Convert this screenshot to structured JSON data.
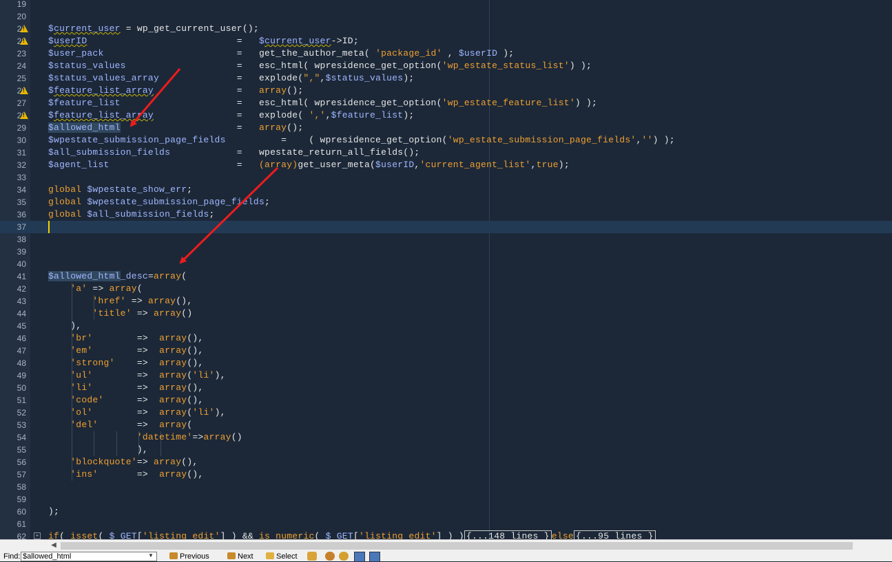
{
  "editor": {
    "lines": [
      {
        "n": "19",
        "warn": false,
        "parts": []
      },
      {
        "n": "20",
        "warn": false,
        "parts": []
      },
      {
        "n": "21",
        "warn": true,
        "parts": [
          [
            "v",
            "$"
          ],
          [
            "v squig",
            "current_user"
          ],
          [
            "o",
            " = "
          ],
          [
            "f",
            "wp_get_current_user();"
          ]
        ]
      },
      {
        "n": "22",
        "warn": true,
        "parts": [
          [
            "v",
            "$"
          ],
          [
            "v squig",
            "userID"
          ],
          [
            "o",
            "                           =   "
          ],
          [
            "v",
            "$"
          ],
          [
            "v squig",
            "current_user"
          ],
          [
            "f",
            "->ID;"
          ]
        ]
      },
      {
        "n": "23",
        "warn": false,
        "parts": [
          [
            "v",
            "$user_pack"
          ],
          [
            "o",
            "                        =   "
          ],
          [
            "f",
            "get_the_author_meta( "
          ],
          [
            "s",
            "'package_id'"
          ],
          [
            "f",
            " , "
          ],
          [
            "v",
            "$userID"
          ],
          [
            "f",
            " );"
          ]
        ]
      },
      {
        "n": "24",
        "warn": false,
        "parts": [
          [
            "v",
            "$status_values"
          ],
          [
            "o",
            "                    =   "
          ],
          [
            "f",
            "esc_html( wpresidence_get_option("
          ],
          [
            "s",
            "'wp_estate_status_list'"
          ],
          [
            "f",
            ") );"
          ]
        ]
      },
      {
        "n": "25",
        "warn": false,
        "parts": [
          [
            "v",
            "$status_values_array"
          ],
          [
            "o",
            "              =   "
          ],
          [
            "f",
            "explode("
          ],
          [
            "s",
            "\",\""
          ],
          [
            "f",
            ","
          ],
          [
            "v",
            "$status_values"
          ],
          [
            "f",
            ");"
          ]
        ]
      },
      {
        "n": "26",
        "warn": true,
        "parts": [
          [
            "v",
            "$"
          ],
          [
            "v squig",
            "feature_list_array"
          ],
          [
            "o",
            "               =   "
          ],
          [
            "k",
            "array"
          ],
          [
            "f",
            "();"
          ]
        ]
      },
      {
        "n": "27",
        "warn": false,
        "parts": [
          [
            "v",
            "$feature_list"
          ],
          [
            "o",
            "                     =   "
          ],
          [
            "f",
            "esc_html( wpresidence_get_option("
          ],
          [
            "s",
            "'wp_estate_feature_list'"
          ],
          [
            "f",
            ") );"
          ]
        ]
      },
      {
        "n": "28",
        "warn": true,
        "parts": [
          [
            "v",
            "$"
          ],
          [
            "v squig",
            "feature_list_array"
          ],
          [
            "o",
            "               =   "
          ],
          [
            "f",
            "explode( "
          ],
          [
            "s",
            "','"
          ],
          [
            "f",
            ","
          ],
          [
            "v",
            "$feature_list"
          ],
          [
            "f",
            ");"
          ]
        ]
      },
      {
        "n": "29",
        "warn": false,
        "parts": [
          [
            "v sel",
            "$allowed_html"
          ],
          [
            "o",
            "                     =   "
          ],
          [
            "k",
            "array"
          ],
          [
            "f",
            "();"
          ]
        ]
      },
      {
        "n": "30",
        "warn": false,
        "parts": [
          [
            "v",
            "$wpestate_submission_page_fields"
          ],
          [
            "o",
            "          =    "
          ],
          [
            "f",
            "( wpresidence_get_option("
          ],
          [
            "s",
            "'wp_estate_submission_page_fields'"
          ],
          [
            "f",
            ","
          ],
          [
            "s",
            "''"
          ],
          [
            "f",
            ") );"
          ]
        ]
      },
      {
        "n": "31",
        "warn": false,
        "parts": [
          [
            "v",
            "$all_submission_fields"
          ],
          [
            "o",
            "            =   "
          ],
          [
            "f",
            "wpestate_return_all_fields();"
          ]
        ]
      },
      {
        "n": "32",
        "warn": false,
        "parts": [
          [
            "v",
            "$agent_list"
          ],
          [
            "o",
            "                       =   "
          ],
          [
            "k",
            "(array)"
          ],
          [
            "f",
            "get_user_meta("
          ],
          [
            "v",
            "$userID"
          ],
          [
            "f",
            ","
          ],
          [
            "s",
            "'current_agent_list'"
          ],
          [
            "f",
            ","
          ],
          [
            "k",
            "true"
          ],
          [
            "f",
            ");"
          ]
        ]
      },
      {
        "n": "33",
        "warn": false,
        "parts": []
      },
      {
        "n": "34",
        "warn": false,
        "parts": [
          [
            "k",
            "global "
          ],
          [
            "v",
            "$wpestate_show_err"
          ],
          [
            "f",
            ";"
          ]
        ]
      },
      {
        "n": "35",
        "warn": false,
        "parts": [
          [
            "k",
            "global "
          ],
          [
            "v",
            "$wpestate_submission_page_fields"
          ],
          [
            "f",
            ";"
          ]
        ]
      },
      {
        "n": "36",
        "warn": false,
        "parts": [
          [
            "k",
            "global "
          ],
          [
            "v",
            "$all_submission_fields"
          ],
          [
            "f",
            ";"
          ]
        ]
      },
      {
        "n": "37",
        "warn": false,
        "current": true,
        "parts": []
      },
      {
        "n": "38",
        "warn": false,
        "parts": []
      },
      {
        "n": "39",
        "warn": false,
        "parts": []
      },
      {
        "n": "40",
        "warn": false,
        "parts": []
      },
      {
        "n": "41",
        "warn": false,
        "parts": [
          [
            "v sel",
            "$allowed_html"
          ],
          [
            "v",
            "_desc"
          ],
          [
            "f",
            "="
          ],
          [
            "k",
            "array"
          ],
          [
            "f",
            "("
          ]
        ]
      },
      {
        "n": "42",
        "warn": false,
        "guides": [
          1
        ],
        "parts": [
          [
            "f",
            "    "
          ],
          [
            "s",
            "'a'"
          ],
          [
            "f",
            " => "
          ],
          [
            "k",
            "array"
          ],
          [
            "f",
            "("
          ]
        ]
      },
      {
        "n": "43",
        "warn": false,
        "guides": [
          1,
          2
        ],
        "parts": [
          [
            "f",
            "        "
          ],
          [
            "s",
            "'href'"
          ],
          [
            "f",
            " => "
          ],
          [
            "k",
            "array"
          ],
          [
            "f",
            "(),"
          ]
        ]
      },
      {
        "n": "44",
        "warn": false,
        "guides": [
          1,
          2
        ],
        "parts": [
          [
            "f",
            "        "
          ],
          [
            "s",
            "'title'"
          ],
          [
            "f",
            " => "
          ],
          [
            "k",
            "array"
          ],
          [
            "f",
            "()"
          ]
        ]
      },
      {
        "n": "45",
        "warn": false,
        "guides": [
          1
        ],
        "parts": [
          [
            "f",
            "    ),"
          ]
        ]
      },
      {
        "n": "46",
        "warn": false,
        "guides": [
          1
        ],
        "parts": [
          [
            "f",
            "    "
          ],
          [
            "s",
            "'br'"
          ],
          [
            "f",
            "        =>  "
          ],
          [
            "k",
            "array"
          ],
          [
            "f",
            "(),"
          ]
        ]
      },
      {
        "n": "47",
        "warn": false,
        "guides": [
          1
        ],
        "parts": [
          [
            "f",
            "    "
          ],
          [
            "s",
            "'em'"
          ],
          [
            "f",
            "        =>  "
          ],
          [
            "k",
            "array"
          ],
          [
            "f",
            "(),"
          ]
        ]
      },
      {
        "n": "48",
        "warn": false,
        "guides": [
          1
        ],
        "parts": [
          [
            "f",
            "    "
          ],
          [
            "s",
            "'strong'"
          ],
          [
            "f",
            "    =>  "
          ],
          [
            "k",
            "array"
          ],
          [
            "f",
            "(),"
          ]
        ]
      },
      {
        "n": "49",
        "warn": false,
        "guides": [
          1
        ],
        "parts": [
          [
            "f",
            "    "
          ],
          [
            "s",
            "'ul'"
          ],
          [
            "f",
            "        =>  "
          ],
          [
            "k",
            "array"
          ],
          [
            "f",
            "("
          ],
          [
            "s",
            "'li'"
          ],
          [
            "f",
            "),"
          ]
        ]
      },
      {
        "n": "50",
        "warn": false,
        "guides": [
          1
        ],
        "parts": [
          [
            "f",
            "    "
          ],
          [
            "s",
            "'li'"
          ],
          [
            "f",
            "        =>  "
          ],
          [
            "k",
            "array"
          ],
          [
            "f",
            "(),"
          ]
        ]
      },
      {
        "n": "51",
        "warn": false,
        "guides": [
          1
        ],
        "parts": [
          [
            "f",
            "    "
          ],
          [
            "s",
            "'code'"
          ],
          [
            "f",
            "      =>  "
          ],
          [
            "k",
            "array"
          ],
          [
            "f",
            "(),"
          ]
        ]
      },
      {
        "n": "52",
        "warn": false,
        "guides": [
          1
        ],
        "parts": [
          [
            "f",
            "    "
          ],
          [
            "s",
            "'ol'"
          ],
          [
            "f",
            "        =>  "
          ],
          [
            "k",
            "array"
          ],
          [
            "f",
            "("
          ],
          [
            "s",
            "'li'"
          ],
          [
            "f",
            "),"
          ]
        ]
      },
      {
        "n": "53",
        "warn": false,
        "guides": [
          1
        ],
        "parts": [
          [
            "f",
            "    "
          ],
          [
            "s",
            "'del'"
          ],
          [
            "f",
            "       =>  "
          ],
          [
            "k",
            "array"
          ],
          [
            "f",
            "("
          ]
        ]
      },
      {
        "n": "54",
        "warn": false,
        "guides": [
          1,
          2,
          3,
          4,
          5
        ],
        "parts": [
          [
            "f",
            "                "
          ],
          [
            "s",
            "'datetime'"
          ],
          [
            "f",
            "=>"
          ],
          [
            "k",
            "array"
          ],
          [
            "f",
            "()"
          ]
        ]
      },
      {
        "n": "55",
        "warn": false,
        "guides": [
          1,
          2,
          3,
          4,
          5
        ],
        "parts": [
          [
            "f",
            "                ),"
          ]
        ]
      },
      {
        "n": "56",
        "warn": false,
        "guides": [
          1
        ],
        "parts": [
          [
            "f",
            "    "
          ],
          [
            "s",
            "'blockquote'"
          ],
          [
            "f",
            "=> "
          ],
          [
            "k",
            "array"
          ],
          [
            "f",
            "(),"
          ]
        ]
      },
      {
        "n": "57",
        "warn": false,
        "guides": [
          1
        ],
        "parts": [
          [
            "f",
            "    "
          ],
          [
            "s",
            "'ins'"
          ],
          [
            "f",
            "       =>  "
          ],
          [
            "k",
            "array"
          ],
          [
            "f",
            "(),"
          ]
        ]
      },
      {
        "n": "58",
        "warn": false,
        "parts": []
      },
      {
        "n": "59",
        "warn": false,
        "parts": []
      },
      {
        "n": "60",
        "warn": false,
        "parts": [
          [
            "f",
            ");"
          ]
        ]
      },
      {
        "n": "61",
        "warn": false,
        "parts": []
      },
      {
        "n": "62",
        "warn": false,
        "parts": [
          [
            "k",
            "if"
          ],
          [
            "f",
            "( "
          ],
          [
            "k",
            "isset"
          ],
          [
            "f",
            "( "
          ],
          [
            "v",
            "$_GET"
          ],
          [
            "f",
            "["
          ],
          [
            "s",
            "'listing_edit'"
          ],
          [
            "f",
            "] ) && "
          ],
          [
            "k",
            "is_numeric"
          ],
          [
            "f",
            "( "
          ],
          [
            "v",
            "$_GET"
          ],
          [
            "f",
            "["
          ],
          [
            "s",
            "'listing_edit'"
          ],
          [
            "f",
            "] ) )"
          ],
          [
            "fold",
            "{...148 lines }"
          ],
          [
            "k",
            "else"
          ],
          [
            "fold",
            "{...95 lines }"
          ]
        ]
      }
    ]
  },
  "findbar": {
    "label": "Find:",
    "value": "$allowed_html",
    "previous": "Previous",
    "next": "Next",
    "select": "Select"
  },
  "colors": {
    "background": "#1c2838",
    "variable": "#a0b6ff",
    "string": "#f0a030",
    "keyword": "#f0a030",
    "arrow": "#ee1c1c",
    "warning": "#e6b800"
  }
}
